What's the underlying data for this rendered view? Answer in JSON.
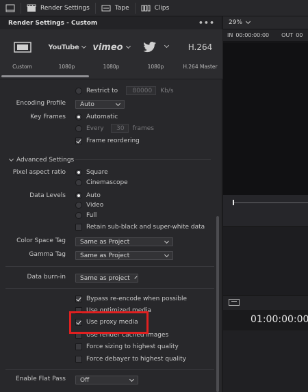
{
  "toolbar": {
    "render_settings": "Render Settings",
    "tape": "Tape",
    "clips": "Clips"
  },
  "panel": {
    "title": "Render Settings - Custom",
    "menu": "•••"
  },
  "presets": [
    {
      "logo": "",
      "sub": "Custom"
    },
    {
      "logo": "YouTube",
      "sub": "1080p"
    },
    {
      "logo": "vimeo",
      "sub": "1080p"
    },
    {
      "logo": "",
      "sub": "1080p"
    },
    {
      "logo": "H.264",
      "sub": "H.264 Master"
    }
  ],
  "settings": {
    "restrict_to_label": "Restrict to",
    "restrict_to_value": "80000",
    "restrict_to_unit": "Kb/s",
    "encoding_profile_label": "Encoding Profile",
    "encoding_profile_value": "Auto",
    "key_frames_label": "Key Frames",
    "key_frames_auto": "Automatic",
    "key_frames_every": "Every",
    "key_frames_every_value": "30",
    "key_frames_unit": "frames",
    "frame_reordering": "Frame reordering",
    "advanced_settings": "Advanced Settings",
    "pixel_aspect_label": "Pixel aspect ratio",
    "pixel_aspect_square": "Square",
    "pixel_aspect_cinemascope": "Cinemascope",
    "data_levels_label": "Data Levels",
    "data_levels_auto": "Auto",
    "data_levels_video": "Video",
    "data_levels_full": "Full",
    "retain_sub_black": "Retain sub-black and super-white data",
    "color_space_label": "Color Space Tag",
    "color_space_value": "Same as Project",
    "gamma_tag_label": "Gamma Tag",
    "gamma_tag_value": "Same as Project",
    "data_burn_in_label": "Data burn-in",
    "data_burn_in_value": "Same as project",
    "bypass_reencode": "Bypass re-encode when possible",
    "use_optimized": "Use optimized media",
    "use_proxy": "Use proxy media",
    "use_render_cached": "Use render cached images",
    "force_sizing": "Force sizing to highest quality",
    "force_debayer": "Force debayer to highest quality",
    "enable_flat_pass_label": "Enable Flat Pass",
    "enable_flat_pass_value": "Off"
  },
  "viewer": {
    "zoom": "29%",
    "in_label": "IN",
    "in_tc": "00:00:00:00",
    "out_label": "OUT",
    "out_tc": "00",
    "timecode": "01:00:00:00"
  },
  "colors": {
    "highlight": "#e02020",
    "panel_bg": "#28282b"
  }
}
